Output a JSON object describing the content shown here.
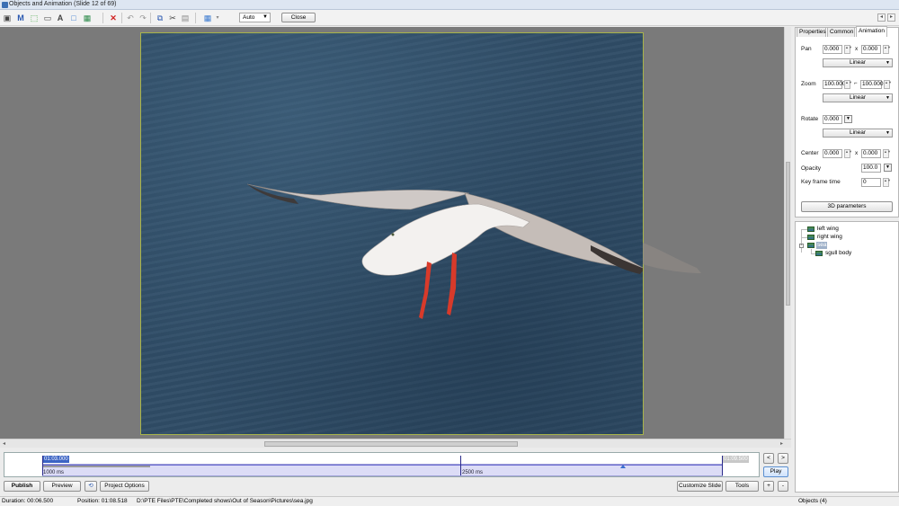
{
  "window": {
    "title": "Objects and Animation  (Slide 12 of 69)"
  },
  "toolbar": {
    "icons": [
      "camera-icon",
      "text-m-icon",
      "frame-icon",
      "image-frame-icon",
      "text-a-icon",
      "rectangle-icon",
      "picture-icon",
      "delete-icon",
      "undo-icon",
      "redo-icon",
      "copy-icon",
      "cut-icon",
      "paste-icon",
      "grid-icon"
    ],
    "auto_value": "Auto",
    "close_label": "Close"
  },
  "timeline": {
    "start_time": "01:03.000",
    "end_time": "01:09.500",
    "marker_left": "1000 ms",
    "marker_mid": "2500 ms"
  },
  "buttons": {
    "publish": "Publish",
    "preview": "Preview",
    "project_options": "Project Options",
    "customize_slide": "Customize Slide",
    "tools": "Tools",
    "play": "Play",
    "prev": "<",
    "next": ">",
    "plus": "+",
    "minus": "-"
  },
  "status": {
    "duration": "Duration:  00:06.500",
    "position": "Position:  01:08.518",
    "path": "D:\\PTE Files\\PTE\\Completed shows\\Out of Season\\Pictures\\sea.jpg",
    "objects": "Objects (4)"
  },
  "tabs": [
    "Properties",
    "Common",
    "Animation"
  ],
  "animation": {
    "pan_label": "Pan",
    "pan_x": "0.000",
    "pan_y": "0.000",
    "x_label": "x",
    "pan_mode": "Linear",
    "zoom_label": "Zoom",
    "zoom_x": "100.000",
    "zoom_y": "100.000",
    "zoom_mode": "Linear",
    "rotate_label": "Rotate",
    "rotate_value": "0.000",
    "rotate_mode": "Linear",
    "center_label": "Center",
    "center_x": "0.000",
    "center_y": "0.000",
    "opacity_label": "Opacity",
    "opacity_value": "100.0",
    "keyframe_label": "Key frame time",
    "keyframe_value": "0",
    "params_button": "3D parameters"
  },
  "tree": {
    "items": [
      "left wing",
      "right wing",
      "sea",
      "sgull body"
    ]
  }
}
